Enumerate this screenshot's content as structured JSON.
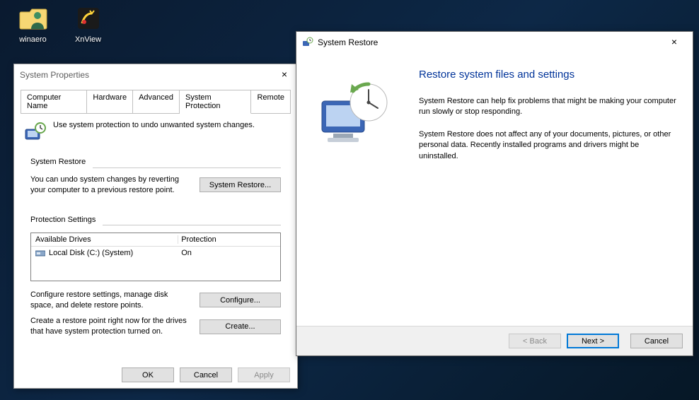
{
  "desktop": {
    "icons": [
      {
        "label": "winaero"
      },
      {
        "label": "XnView"
      }
    ]
  },
  "sysprops": {
    "title": "System Properties",
    "tabs": [
      "Computer Name",
      "Hardware",
      "Advanced",
      "System Protection",
      "Remote"
    ],
    "active_tab_index": 3,
    "hint": "Use system protection to undo unwanted system changes.",
    "group_restore": {
      "title": "System Restore",
      "text": "You can undo system changes by reverting your computer to a previous restore point.",
      "button": "System Restore..."
    },
    "group_settings": {
      "title": "Protection Settings",
      "columns": [
        "Available Drives",
        "Protection"
      ],
      "rows": [
        {
          "drive": "Local Disk (C:) (System)",
          "protection": "On"
        }
      ],
      "configure_text": "Configure restore settings, manage disk space, and delete restore points.",
      "configure_button": "Configure...",
      "create_text": "Create a restore point right now for the drives that have system protection turned on.",
      "create_button": "Create..."
    },
    "buttons": {
      "ok": "OK",
      "cancel": "Cancel",
      "apply": "Apply"
    }
  },
  "restore_wizard": {
    "title": "System Restore",
    "heading": "Restore system files and settings",
    "para1": "System Restore can help fix problems that might be making your computer run slowly or stop responding.",
    "para2": "System Restore does not affect any of your documents, pictures, or other personal data. Recently installed programs and drivers might be uninstalled.",
    "buttons": {
      "back": "< Back",
      "next": "Next >",
      "cancel": "Cancel"
    }
  }
}
